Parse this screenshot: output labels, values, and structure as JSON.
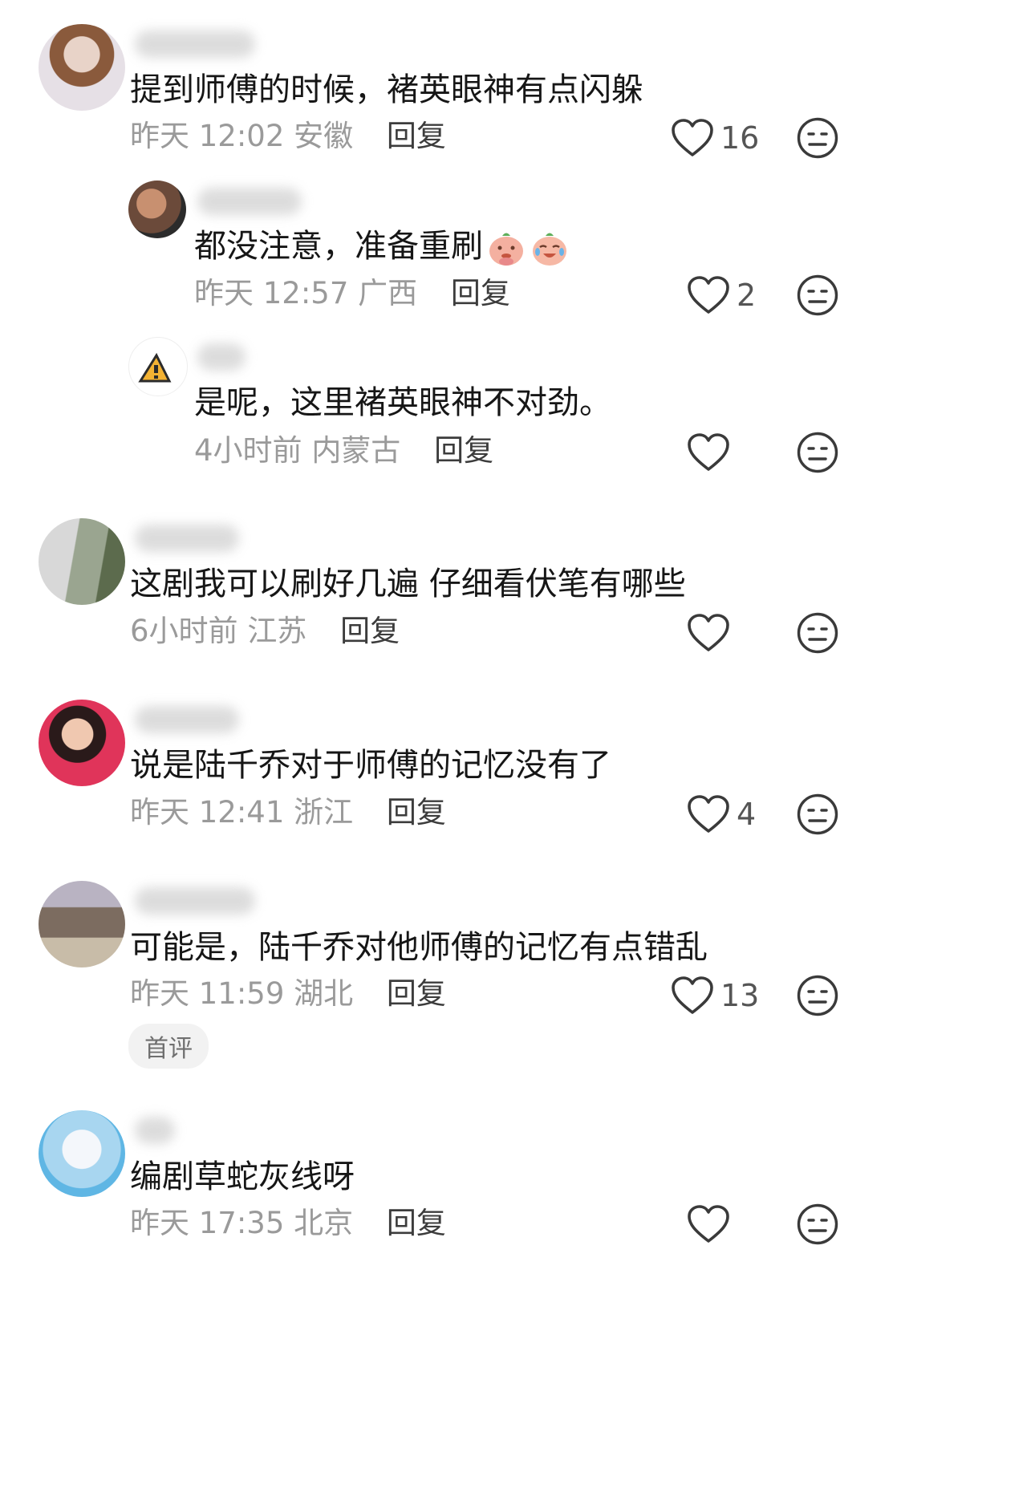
{
  "comments": [
    {
      "text": "提到师傅的时候，褚英眼神有点闪躲",
      "time": "昨天 12:02",
      "location": "安徽",
      "reply_label": "回复",
      "likes": "16",
      "replies": [
        {
          "text": "都没注意，准备重刷",
          "emoji_icons": [
            "praying-peach-icon",
            "crying-laughing-peach-icon"
          ],
          "time": "昨天 12:57",
          "location": "广西",
          "reply_label": "回复",
          "likes": "2"
        },
        {
          "text": "是呢，这里褚英眼神不对劲。",
          "time": "4小时前",
          "location": "内蒙古",
          "reply_label": "回复",
          "likes": ""
        }
      ]
    },
    {
      "text": "这剧我可以刷好几遍 仔细看伏笔有哪些",
      "time": "6小时前",
      "location": "江苏",
      "reply_label": "回复",
      "likes": ""
    },
    {
      "text": "说是陆千乔对于师傅的记忆没有了",
      "time": "昨天 12:41",
      "location": "浙江",
      "reply_label": "回复",
      "likes": "4"
    },
    {
      "text": "可能是，陆千乔对他师傅的记忆有点错乱",
      "time": "昨天 11:59",
      "location": "湖北",
      "reply_label": "回复",
      "likes": "13",
      "badge": "首评"
    },
    {
      "text": "编剧草蛇灰线呀",
      "time": "昨天 17:35",
      "location": "北京",
      "reply_label": "回复",
      "likes": ""
    }
  ],
  "icons": {
    "like": "heart-outline-icon",
    "dislike": "neutral-face-icon"
  },
  "colors": {
    "text": "#161616",
    "meta": "#9a9a9a",
    "reply": "#3c3c3c",
    "badge_bg": "#f2f2f2"
  }
}
